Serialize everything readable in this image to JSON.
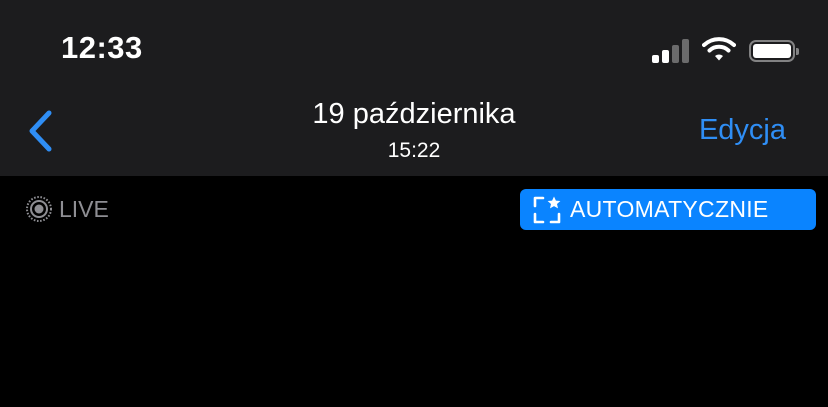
{
  "status_bar": {
    "time": "12:33",
    "signal_bars_active": 2,
    "signal_bars_total": 4,
    "wifi_icon": "wifi-icon",
    "battery_icon": "battery-full-icon"
  },
  "nav": {
    "back_icon": "chevron-left-icon",
    "title": "19 października",
    "subtitle": "15:22",
    "edit_label": "Edycja"
  },
  "photo": {
    "live_icon": "live-photo-icon",
    "live_label": "LIVE",
    "auto_icon": "auto-enhance-icon",
    "auto_label": "AUTOMATYCZNIE"
  },
  "colors": {
    "accent": "#2f8ef5",
    "auto_badge": "#0a84ff",
    "header_bg": "#1c1c1e",
    "background": "#000000",
    "live_gray": "#8e8e93"
  }
}
